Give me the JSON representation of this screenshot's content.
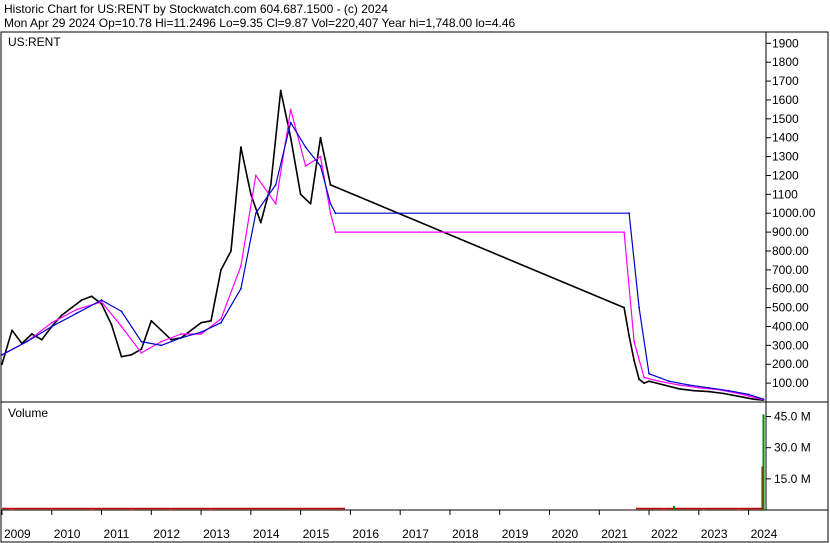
{
  "header": {
    "line1": "Historic Chart for US:RENT by Stockwatch.com 604.687.1500 - (c) 2024",
    "line2": "Mon Apr 29 2024   Op=10.78   Hi=11.2496   Lo=9.35   Cl=9.87   Vol=220,407   Year hi=1,748.00   lo=4.46"
  },
  "colors": {
    "background": "#ffffff",
    "border": "#000000",
    "price_bars": "#000000",
    "ma_fast": "#ff00ff",
    "ma_slow": "#0000cc",
    "volume_red": "#cc0000",
    "volume_green": "#008800"
  },
  "chart_data": [
    {
      "type": "line",
      "title": "US:RENT",
      "series": [
        {
          "name": "",
          "role": "price",
          "x": [
            2009.0,
            2009.2,
            2009.4,
            2009.6,
            2009.8,
            2010.0,
            2010.2,
            2010.4,
            2010.6,
            2010.8,
            2011.0,
            2011.2,
            2011.4,
            2011.6,
            2011.8,
            2012.0,
            2012.2,
            2012.4,
            2012.6,
            2012.8,
            2013.0,
            2013.2,
            2013.4,
            2013.6,
            2013.8,
            2014.0,
            2014.2,
            2014.4,
            2014.6,
            2014.8,
            2015.0,
            2015.2,
            2015.4,
            2015.6,
            2021.5,
            2021.6,
            2021.7,
            2021.8,
            2021.9,
            2022.0,
            2022.3,
            2022.6,
            2022.9,
            2023.2,
            2023.5,
            2023.8,
            2024.1,
            2024.3
          ],
          "values": [
            200,
            380,
            310,
            360,
            330,
            400,
            460,
            500,
            540,
            560,
            520,
            410,
            240,
            250,
            280,
            430,
            380,
            330,
            340,
            380,
            420,
            430,
            700,
            800,
            1350,
            1100,
            950,
            1150,
            1650,
            1400,
            1100,
            1050,
            1400,
            1150,
            500,
            350,
            220,
            120,
            100,
            110,
            90,
            70,
            60,
            55,
            45,
            30,
            15,
            10
          ]
        },
        {
          "name": "",
          "role": "moving-average-fast",
          "x": [
            2009.0,
            2009.5,
            2010.0,
            2010.5,
            2011.0,
            2011.4,
            2011.8,
            2012.2,
            2012.6,
            2013.0,
            2013.4,
            2013.8,
            2014.1,
            2014.5,
            2014.8,
            2015.1,
            2015.4,
            2015.6,
            2015.7,
            2021.5,
            2021.7,
            2021.9,
            2022.2,
            2022.6,
            2023.0,
            2023.4,
            2023.8,
            2024.3
          ],
          "values": [
            250,
            320,
            420,
            490,
            530,
            400,
            260,
            320,
            360,
            360,
            440,
            720,
            1200,
            1050,
            1550,
            1250,
            1300,
            1000,
            900,
            900,
            320,
            130,
            110,
            90,
            75,
            65,
            45,
            12
          ]
        },
        {
          "name": "",
          "role": "moving-average-slow",
          "x": [
            2009.0,
            2009.5,
            2010.0,
            2010.5,
            2011.0,
            2011.4,
            2011.8,
            2012.2,
            2012.6,
            2013.0,
            2013.4,
            2013.8,
            2014.1,
            2014.5,
            2014.8,
            2015.1,
            2015.4,
            2015.6,
            2015.7,
            2021.6,
            2021.8,
            2022.0,
            2022.4,
            2022.8,
            2023.2,
            2023.6,
            2024.0,
            2024.3
          ],
          "values": [
            250,
            320,
            400,
            470,
            540,
            480,
            320,
            300,
            340,
            370,
            420,
            600,
            1000,
            1150,
            1480,
            1350,
            1250,
            1050,
            1000,
            1000,
            500,
            150,
            110,
            90,
            75,
            60,
            40,
            15
          ]
        }
      ],
      "y_ticks": [
        1900,
        1800,
        1700,
        1600,
        1500,
        1400,
        1300,
        1200,
        1100,
        "1000.00",
        "900.00",
        "800.00",
        "700.00",
        "600.00",
        "500.00",
        "400.00",
        "300.00",
        "200.00",
        "100.00"
      ],
      "ylim": [
        0,
        1960
      ],
      "grid": false
    },
    {
      "type": "bar",
      "title": "Volume",
      "series": [
        {
          "name": "",
          "role": "volume-down",
          "x": [
            2009.2,
            2010.0,
            2010.8,
            2011.6,
            2012.4,
            2013.2,
            2014.0,
            2014.8,
            2015.5,
            2021.6,
            2022.3,
            2023.1,
            2023.8,
            2024.28
          ],
          "values": [
            0.3,
            0.3,
            0.3,
            0.3,
            0.3,
            0.3,
            0.4,
            0.4,
            0.4,
            0.3,
            0.3,
            0.3,
            0.3,
            21
          ]
        },
        {
          "name": "",
          "role": "volume-up",
          "x": [
            2022.5,
            2024.3
          ],
          "values": [
            2,
            46
          ]
        }
      ],
      "y_ticks": [
        "45.0 M",
        "30.0 M",
        "15.0 M"
      ],
      "ylim": [
        0,
        52
      ],
      "x_ticks": [
        "2009",
        "2010",
        "2011",
        "2012",
        "2013",
        "2014",
        "2015",
        "2016",
        "2017",
        "2018",
        "2019",
        "2020",
        "2021",
        "2022",
        "2023",
        "2024"
      ]
    }
  ]
}
